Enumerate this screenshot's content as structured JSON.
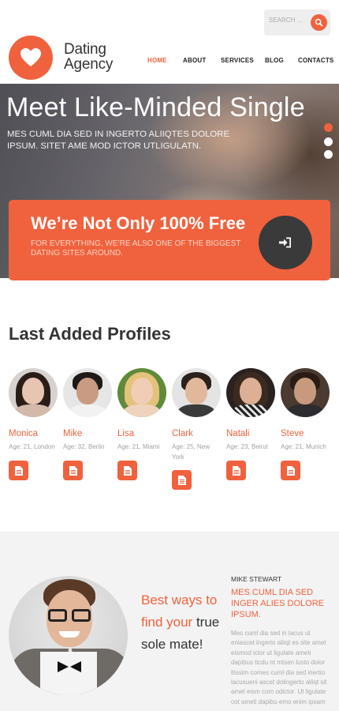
{
  "header": {
    "search_placeholder": "SEARCH ...",
    "logo_line1": "Dating",
    "logo_line2": "Agency",
    "nav": [
      "HOME",
      "ABOUT",
      "SERVICES",
      "BLOG",
      "CONTACTS"
    ],
    "active_nav": "HOME"
  },
  "hero": {
    "title": "Meet Like-Minded Single",
    "subtitle": "MES CUML DIA SED IN INGERTO ALIIQTES DOLORE IPSUM. SITET AME MOD ICTOR UTLIGULATN.",
    "slides": 3,
    "active_slide": 0
  },
  "promo": {
    "title": "We’re Not Only 100% Free",
    "subtitle": "FOR EVERYTHING, WE’RE ALSO ONE OF THE BIGGEST DATING SITES AROUND."
  },
  "profiles": {
    "title": "Last Added Profiles",
    "items": [
      {
        "name": "Monica",
        "info": "Age: 21, London"
      },
      {
        "name": "Mike",
        "info": "Age: 32, Berlin"
      },
      {
        "name": "Lisa",
        "info": "Age: 21, Miami"
      },
      {
        "name": "Clark",
        "info": "Age: 25, New York"
      },
      {
        "name": "Natali",
        "info": "Age: 23, Beirut"
      },
      {
        "name": "Steve",
        "info": "Age: 21, Munich"
      }
    ]
  },
  "feature": {
    "tagline_accent": "Best ways to find your",
    "tagline_rest": "true sole mate!",
    "author": "MIKE STEWART",
    "quote_title": "MES CUML DIA SED INGER ALIES DOLORE IPSUM.",
    "quote_text": "Mes cuml dia sed in lacus ut eniascet ingerto aliiqt es site amet eismod ictor ut ligulate ameti dapibus ticdu nt mtsen lusto dolor ltissim comes cuml dia sed inertio lacusueni ascet dolingerto aliiqt sit amet eism com odictor. Ut ligulate cot ameti dapibu emo enim ipsam"
  },
  "colors": {
    "accent": "#f0623d",
    "dark": "#3a3a3a"
  }
}
